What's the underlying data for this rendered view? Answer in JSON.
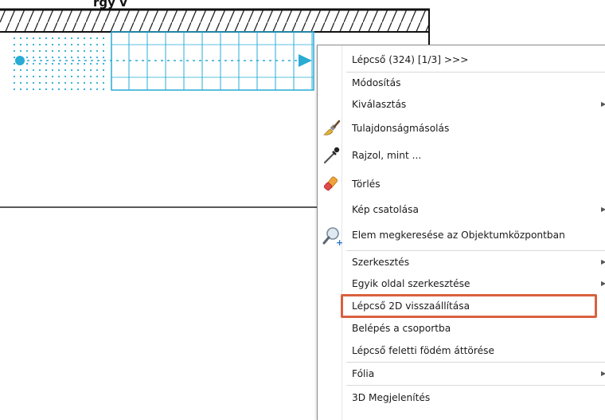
{
  "top_caption": "rgy v",
  "colors": {
    "stair_blue": "#29abd4",
    "highlight": "#d9603f"
  },
  "menu": {
    "items": [
      {
        "label": "Lépcső (324) [1/3] >>>",
        "submenu": false,
        "icon": ""
      },
      {
        "label": "Módosítás",
        "submenu": false,
        "icon": ""
      },
      {
        "label": "Kiválasztás",
        "submenu": true,
        "icon": ""
      },
      {
        "label": "Tulajdonságmásolás",
        "submenu": false,
        "icon": "paint-brush-icon"
      },
      {
        "label": "Rajzol, mint ...",
        "submenu": false,
        "icon": "eyedropper-icon"
      },
      {
        "label": "Törlés",
        "submenu": false,
        "icon": "eraser-icon"
      },
      {
        "label": "Kép csatolása",
        "submenu": true,
        "icon": ""
      },
      {
        "label": "Elem megkeresése az Objektumközpontban",
        "submenu": false,
        "icon": "magnifier-add-icon"
      },
      {
        "label": "Szerkesztés",
        "submenu": true,
        "icon": ""
      },
      {
        "label": "Egyik oldal szerkesztése",
        "submenu": true,
        "icon": ""
      },
      {
        "label": "Lépcső 2D visszaállítása",
        "submenu": false,
        "icon": ""
      },
      {
        "label": "Belépés a csoportba",
        "submenu": false,
        "icon": ""
      },
      {
        "label": "Lépcső feletti födém áttörése",
        "submenu": false,
        "icon": ""
      },
      {
        "label": "Fólia",
        "submenu": true,
        "icon": ""
      },
      {
        "label": "3D Megjelenítés",
        "submenu": false,
        "icon": ""
      }
    ],
    "highlighted_item": "Lépcső 2D visszaállítása"
  }
}
